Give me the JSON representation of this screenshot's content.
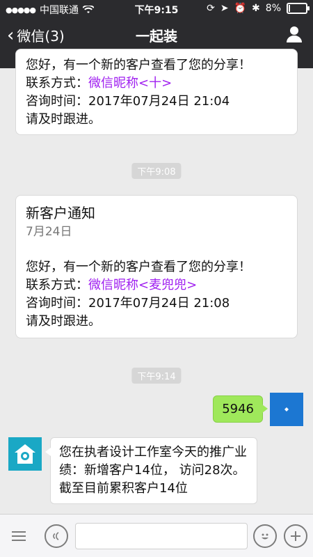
{
  "status": {
    "carrier": "中国联通",
    "time": "下午9:15",
    "battery": "8%"
  },
  "header": {
    "back_label": "微信(3)",
    "title": "一起装"
  },
  "messages": {
    "card1": {
      "line1": "您好，有一个新的客户查看了您的分享！",
      "contact_label": "联系方式：",
      "contact_value": "微信昵称<十>",
      "time_label": "咨询时间：",
      "time_value": "2017年07月24日 21:04",
      "footer": "请及时跟进。"
    },
    "chip1": "下午9:08",
    "card2": {
      "title": "新客户通知",
      "date": "7月24日",
      "line1": "您好，有一个新的客户查看了您的分享！",
      "contact_label": "联系方式：",
      "contact_value": "微信昵称<麦兜兜>",
      "time_label": "咨询时间：",
      "time_value": "2017年07月24日 21:08",
      "footer": "请及时跟进。"
    },
    "chip2": "下午9:14",
    "outgoing_text": "5946",
    "incoming_text": "您在执者设计工作室今天的推广业绩：新增客户14位， 访问28次。截至目前累积客户14位"
  },
  "icons": {
    "back": "chevron-left-icon",
    "profile": "person-icon",
    "voice": "voice-icon",
    "emoji": "emoji-icon",
    "add": "plus-icon",
    "menu": "menu-icon"
  },
  "colors": {
    "nav_bg": "#2b2b2e",
    "outgoing_bubble": "#9fe85b",
    "link_purple": "#a020f0",
    "chat_bg": "#ebebeb"
  }
}
